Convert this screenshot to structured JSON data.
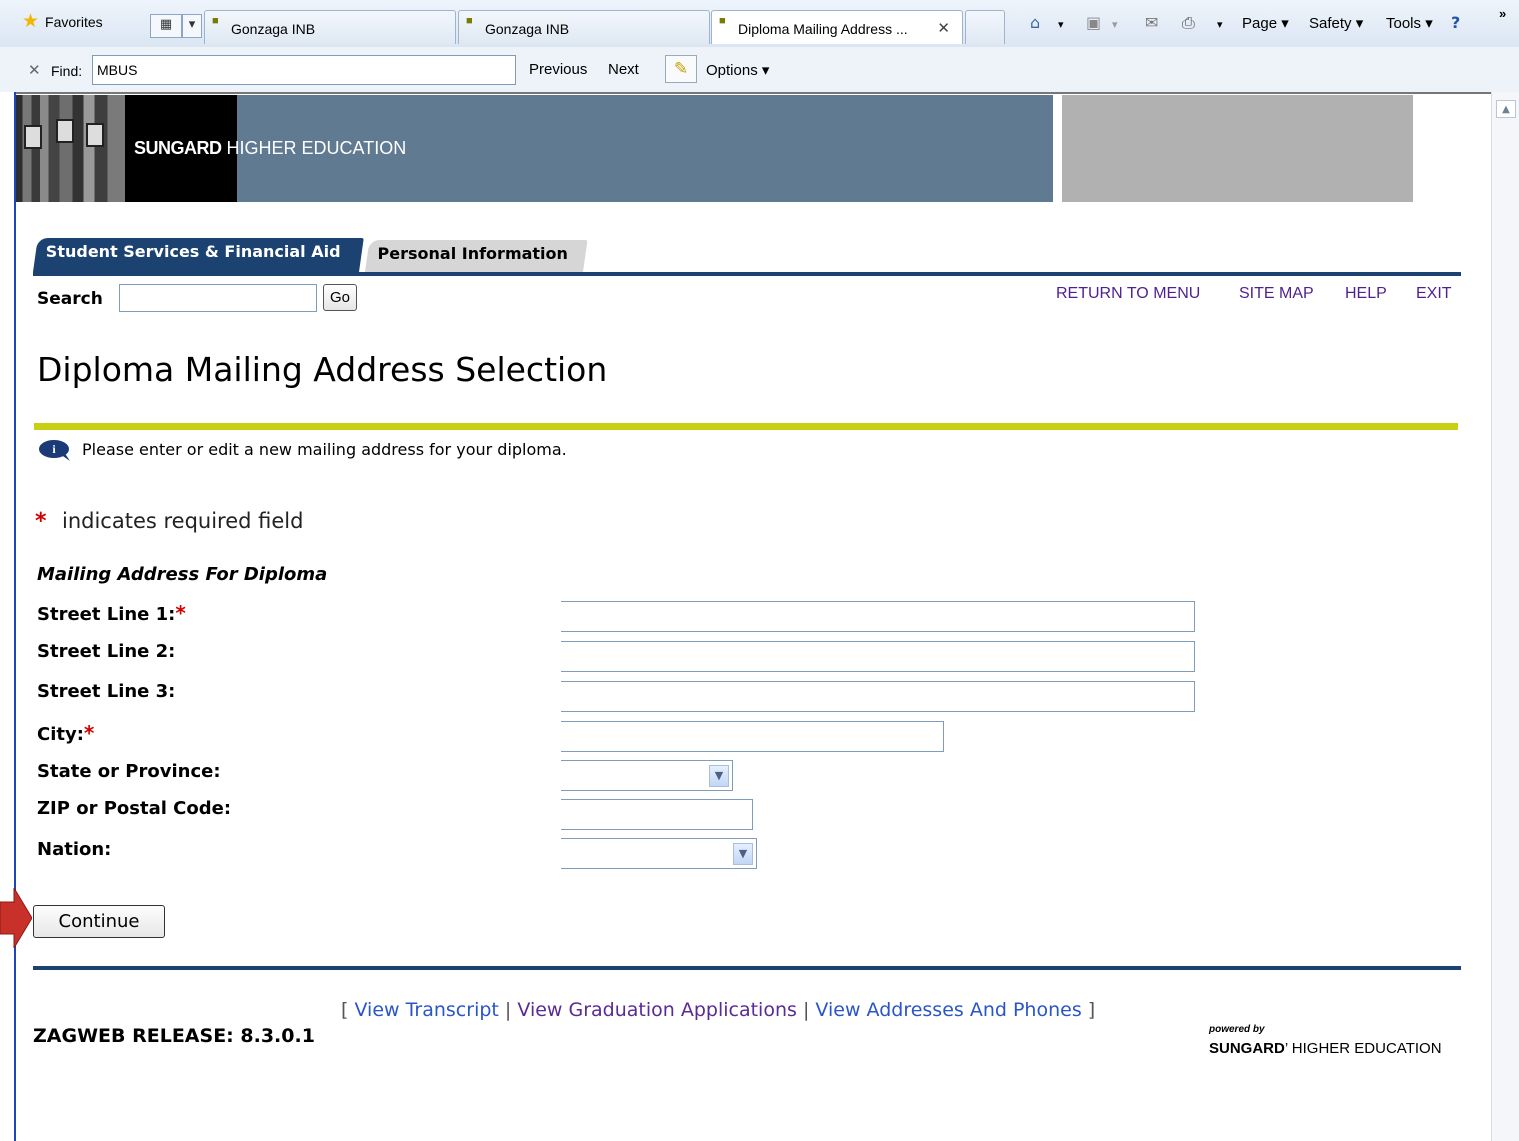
{
  "browser": {
    "favorites_label": "Favorites",
    "tabs": [
      {
        "label": "Gonzaga INB"
      },
      {
        "label": "Gonzaga INB"
      },
      {
        "label": "Diploma Mailing Address ..."
      }
    ],
    "toolbar": {
      "page": "Page",
      "safety": "Safety",
      "tools": "Tools"
    },
    "find": {
      "label": "Find:",
      "value": "MBUS",
      "previous": "Previous",
      "next": "Next",
      "options": "Options"
    }
  },
  "banner": {
    "brand_bold": "SUNGARD",
    "brand_rest": "HIGHER EDUCATION"
  },
  "nav": {
    "tabs": [
      {
        "label": "Student Services & Financial Aid",
        "active": true
      },
      {
        "label": "Personal Information",
        "active": false
      }
    ],
    "search_label": "Search",
    "search_value": "",
    "go_label": "Go",
    "links": [
      "RETURN TO MENU",
      "SITE MAP",
      "HELP",
      "EXIT"
    ]
  },
  "page": {
    "title": "Diploma Mailing Address Selection",
    "info_text": "Please enter or edit a new mailing address for your diploma.",
    "required_star": "*",
    "required_text": "indicates required field"
  },
  "form": {
    "heading": "Mailing Address For Diploma",
    "fields": [
      {
        "label": "Street Line 1:",
        "required": true,
        "type": "text",
        "value": ""
      },
      {
        "label": "Street Line 2:",
        "required": false,
        "type": "text",
        "value": ""
      },
      {
        "label": "Street Line 3:",
        "required": false,
        "type": "text",
        "value": ""
      },
      {
        "label": "City:",
        "required": true,
        "type": "text",
        "value": ""
      },
      {
        "label": "State or Province:",
        "required": false,
        "type": "select",
        "value": ""
      },
      {
        "label": "ZIP or Postal Code:",
        "required": false,
        "type": "text",
        "value": ""
      },
      {
        "label": "Nation:",
        "required": false,
        "type": "select",
        "value": ""
      }
    ],
    "submit_label": "Continue"
  },
  "footer": {
    "open_bracket": "[",
    "close_bracket": "]",
    "separator": "|",
    "links": [
      "View Transcript",
      "View Graduation Applications",
      "View Addresses And Phones"
    ],
    "release": "ZAGWEB RELEASE: 8.3.0.1",
    "powered_by": "powered by",
    "powered_brand_bold": "SUNGARD",
    "powered_brand_rest": "HIGHER EDUCATION"
  },
  "colors": {
    "nav_blue": "#1b4270",
    "banner_blue": "#5f7a91",
    "title_rule": "#c9cf12",
    "required_red": "#d40000",
    "link_purple": "#4f1f8f",
    "link_blue": "#2a55c9"
  },
  "icons": [
    "star-icon",
    "quick-tabs-icon",
    "home-icon",
    "feeds-icon",
    "mail-icon",
    "print-icon",
    "help-icon",
    "info-icon",
    "pencil-icon",
    "close-icon",
    "chevron-down-icon",
    "pointer-arrow-icon"
  ]
}
